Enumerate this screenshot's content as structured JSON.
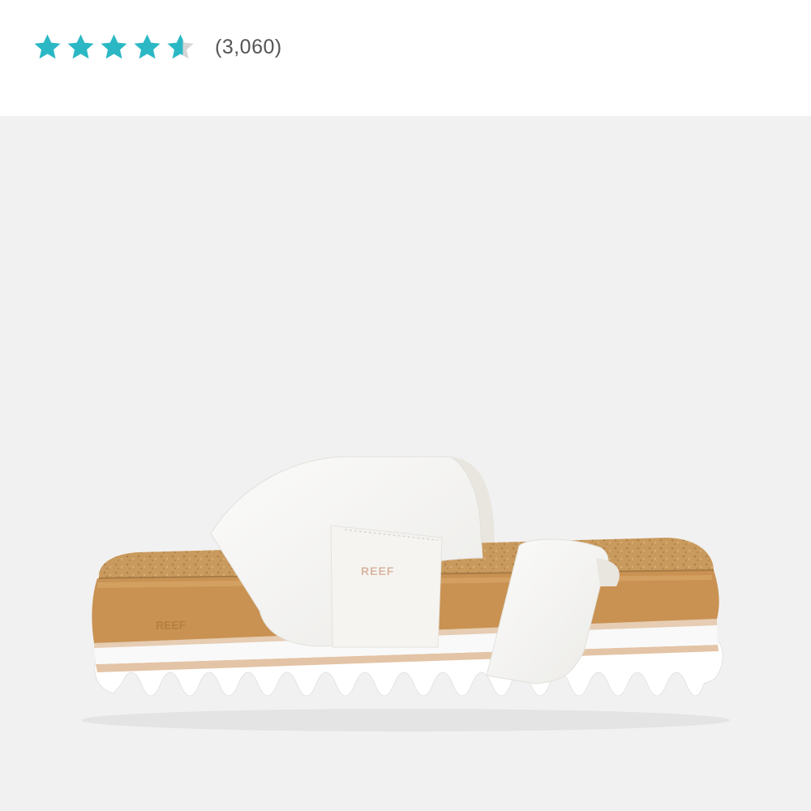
{
  "rating": {
    "value": 4.6,
    "max": 5,
    "review_count": "(3,060)",
    "star_color": "#2bb8c4",
    "empty_star_color": "#d5d5d5"
  },
  "product_image": {
    "background_color": "#f1f1f1",
    "brand_logo": "REEF",
    "colors": {
      "strap": "#f7f7f5",
      "cork": "#c99a5d",
      "midsole": "#c99252",
      "outsole": "#ffffff"
    }
  }
}
